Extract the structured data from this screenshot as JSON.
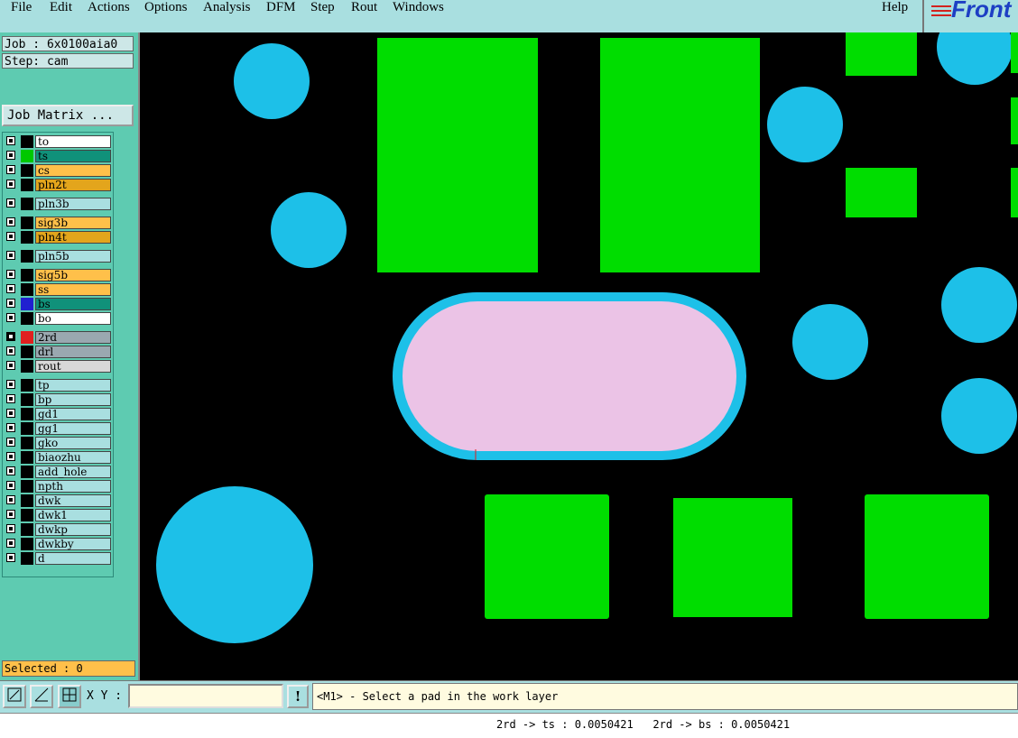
{
  "menu": {
    "file": "File",
    "edit": "Edit",
    "actions": "Actions",
    "options": "Options",
    "analysis": "Analysis",
    "dfm": "DFM",
    "step": "Step",
    "rout": "Rout",
    "windows": "Windows",
    "help": "Help"
  },
  "logo": {
    "text": "Front"
  },
  "job": {
    "job_line": "Job : 6x0100aia0",
    "step_line": "Step: cam",
    "matrix_button": "Job Matrix ..."
  },
  "layers": [
    {
      "name": "to",
      "color": "#ffffff",
      "swatch": "#000000"
    },
    {
      "name": "ts",
      "color": "#10917a",
      "swatch": "#00c800"
    },
    {
      "name": "cs",
      "color": "#ffc04a",
      "swatch": "#000000"
    },
    {
      "name": "pln2t",
      "color": "#e3a51c",
      "swatch": "#000000"
    },
    {
      "name": "pln3b",
      "color": "#a9dfe0",
      "swatch": "#000000"
    },
    {
      "name": "sig3b",
      "color": "#ffc04a",
      "swatch": "#000000"
    },
    {
      "name": "pln4t",
      "color": "#e3a51c",
      "swatch": "#000000"
    },
    {
      "name": "pln5b",
      "color": "#a9dfe0",
      "swatch": "#000000"
    },
    {
      "name": "sig5b",
      "color": "#ffc04a",
      "swatch": "#000000"
    },
    {
      "name": "ss",
      "color": "#ffc04a",
      "swatch": "#000000"
    },
    {
      "name": "bs",
      "color": "#10917a",
      "swatch": "#2020d0"
    },
    {
      "name": "bo",
      "color": "#ffffff",
      "swatch": "#000000"
    },
    {
      "name": "2rd",
      "color": "#9aa8b0",
      "swatch": "#e02020",
      "work": true
    },
    {
      "name": "drl",
      "color": "#9aa8b0",
      "swatch": "#000000"
    },
    {
      "name": "rout",
      "color": "#d8d8d8",
      "swatch": "#000000"
    },
    {
      "name": "tp",
      "color": "#a9dfe0",
      "swatch": "#000000"
    },
    {
      "name": "bp",
      "color": "#a9dfe0",
      "swatch": "#000000"
    },
    {
      "name": "gd1",
      "color": "#a9dfe0",
      "swatch": "#000000"
    },
    {
      "name": "gg1",
      "color": "#a9dfe0",
      "swatch": "#000000"
    },
    {
      "name": "gko",
      "color": "#a9dfe0",
      "swatch": "#000000"
    },
    {
      "name": "biaozhu",
      "color": "#a9dfe0",
      "swatch": "#000000"
    },
    {
      "name": "add_hole",
      "color": "#a9dfe0",
      "swatch": "#000000"
    },
    {
      "name": "npth",
      "color": "#a9dfe0",
      "swatch": "#000000"
    },
    {
      "name": "dwk",
      "color": "#a9dfe0",
      "swatch": "#000000"
    },
    {
      "name": "dwk1",
      "color": "#a9dfe0",
      "swatch": "#000000"
    },
    {
      "name": "dwkp",
      "color": "#a9dfe0",
      "swatch": "#000000"
    },
    {
      "name": "dwkby",
      "color": "#a9dfe0",
      "swatch": "#000000"
    },
    {
      "name": "d",
      "color": "#a9dfe0",
      "swatch": "#000000"
    }
  ],
  "selected": "Selected : 0",
  "toolbar": {
    "xy_label": "X Y :",
    "xy_value": "",
    "bang": "!",
    "prompt": "<M1> - Select a pad in the work layer"
  },
  "status": "2rd -> ts : 0.0050421   2rd -> bs : 0.0050421",
  "colors": {
    "pad_green": "#00dd00",
    "pad_blue": "#1dc0e8",
    "slot_fill": "#ebc3e6",
    "canvas_bg": "#000000"
  }
}
